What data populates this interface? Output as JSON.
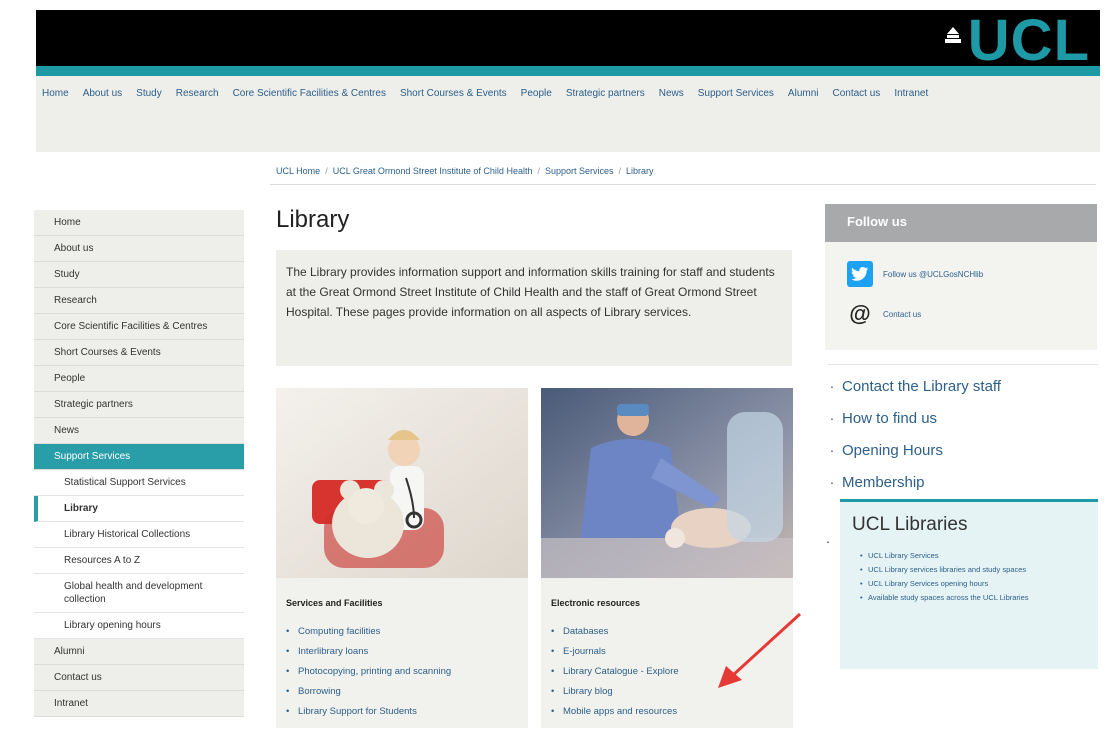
{
  "header": {
    "logo_text": "UCL",
    "brand_color": "#1e9aa6",
    "nav_items": [
      "Home",
      "About us",
      "Study",
      "Research",
      "Core Scientific Facilities & Centres",
      "Short Courses & Events",
      "People",
      "Strategic partners",
      "News",
      "Support Services",
      "Alumni",
      "Contact us",
      "Intranet"
    ]
  },
  "breadcrumb": [
    "UCL Home",
    "UCL Great Ormond Street Institute of Child Health",
    "Support Services",
    "Library"
  ],
  "sidebar": {
    "items": [
      {
        "label": "Home"
      },
      {
        "label": "About us"
      },
      {
        "label": "Study"
      },
      {
        "label": "Research"
      },
      {
        "label": "Core Scientific Facilities & Centres"
      },
      {
        "label": "Short Courses & Events"
      },
      {
        "label": "People"
      },
      {
        "label": "Strategic partners"
      },
      {
        "label": "News"
      },
      {
        "label": "Support Services"
      }
    ],
    "sub_items": [
      {
        "label": "Statistical Support Services"
      },
      {
        "label": "Library"
      },
      {
        "label": "Library Historical Collections"
      },
      {
        "label": "Resources A to Z"
      },
      {
        "label": "Global health and development collection"
      },
      {
        "label": "Library opening hours"
      }
    ],
    "bottom_items": [
      {
        "label": "Alumni"
      },
      {
        "label": "Contact us"
      },
      {
        "label": "Intranet"
      }
    ]
  },
  "main": {
    "title": "Library",
    "intro": "The Library provides information support and information skills training for staff and students at the Great Ormond Street Institute of Child Health and the staff of Great Ormond Street Hospital. These pages provide information on all aspects of Library services.",
    "cards": [
      {
        "title": "Services and Facilities",
        "links": [
          "Computing facilities",
          "Interlibrary loans",
          "Photocopying, printing and scanning",
          "Borrowing",
          "Library Support for Students"
        ]
      },
      {
        "title": "Electronic resources",
        "links": [
          "Databases",
          "E-journals",
          "Library Catalogue - Explore",
          "Library blog",
          "Mobile apps and resources"
        ]
      }
    ]
  },
  "right": {
    "follow_title": "Follow us",
    "twitter_label": "Follow us @UCLGosNCHlib",
    "contact_label": "Contact us",
    "links": [
      "Contact the Library staff",
      "How to find us",
      "Opening Hours",
      "Membership"
    ],
    "libraries_title": "UCL Libraries",
    "libraries_links": [
      "UCL Library Services",
      "UCL Library services libraries and study spaces",
      "UCL Library Services opening hours",
      "Available study spaces across the UCL Libraries"
    ]
  },
  "colors": {
    "accent": "#1e9aa6",
    "link": "#2c5f8a",
    "annotation_arrow": "#e53935"
  }
}
